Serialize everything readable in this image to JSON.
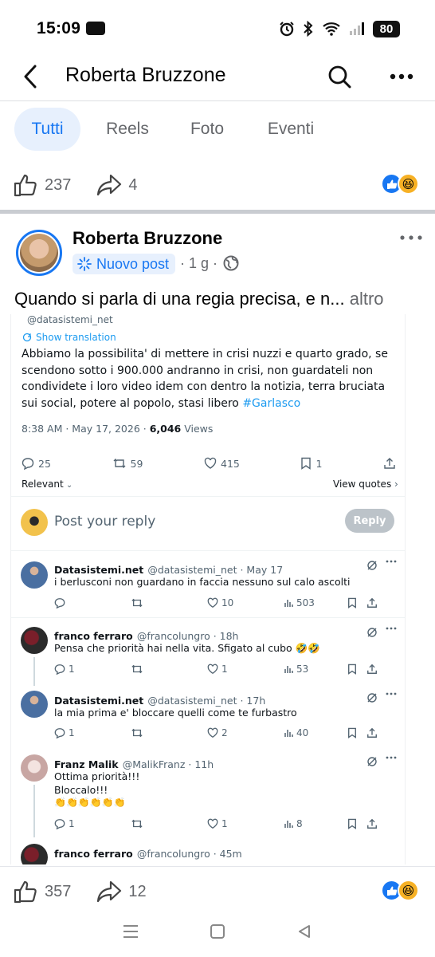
{
  "status_bar": {
    "time": "15:09",
    "battery": "80"
  },
  "header": {
    "title": "Roberta Bruzzone"
  },
  "tabs": [
    {
      "label": "Tutti",
      "active": true
    },
    {
      "label": "Reels",
      "active": false
    },
    {
      "label": "Foto",
      "active": false
    },
    {
      "label": "Eventi",
      "active": false
    }
  ],
  "top_reactions": {
    "likes": "237",
    "shares": "4"
  },
  "post": {
    "author": "Roberta Bruzzone",
    "badge": "Nuovo post",
    "time": "· 1 g ·",
    "text": "Quando si parla di una regia precisa, e n...",
    "more": "altro"
  },
  "embedded": {
    "top_handle": "@datasistemi_net",
    "show_translation": "Show translation",
    "tweet_text": "Abbiamo la possibilita' di mettere in crisi nuzzi e quarto grado, se scendono sotto i 900.000 andranno in crisi, non guardateli non condividete i loro video idem con dentro la notizia, terra bruciata sui social, potere al popolo, stasi libero",
    "hashtag": "#Garlasco",
    "meta_time": "8:38 AM · May 17, 2026 · ",
    "views_count": "6,046",
    "views_label": " Views",
    "stats": {
      "replies": "25",
      "reposts": "59",
      "likes": "415",
      "bookmarks": "1"
    },
    "relevant": "Relevant",
    "view_quotes": "View quotes",
    "reply_placeholder": "Post your reply",
    "reply_button": "Reply",
    "comments": [
      {
        "name": "Datasistemi.net",
        "handle": "@datasistemi_net · May 17",
        "text": "i berlusconi non guardano in faccia nessuno sul calo ascolti",
        "replies": "",
        "reposts": "",
        "likes": "10",
        "views": "503"
      },
      {
        "name": "franco ferraro",
        "handle": "@francolungro · 18h",
        "text": "Pensa che priorità hai nella vita. Sfigato al cubo 🤣🤣",
        "replies": "1",
        "reposts": "",
        "likes": "1",
        "views": "53"
      },
      {
        "name": "Datasistemi.net",
        "handle": "@datasistemi_net · 17h",
        "text": "la mia prima e' bloccare quelli come te furbastro",
        "replies": "1",
        "reposts": "",
        "likes": "2",
        "views": "40"
      },
      {
        "name": "Franz Malik",
        "handle": "@MalikFranz · 11h",
        "text": "Ottima priorità!!!",
        "text2": "Bloccalo!!!",
        "text3": "👏👏👏👏👏👏",
        "replies": "1",
        "reposts": "",
        "likes": "1",
        "views": "8"
      },
      {
        "name": "franco ferraro",
        "handle": "@francolungro · 45m"
      }
    ]
  },
  "bottom_reactions": {
    "likes": "357",
    "shares": "12"
  },
  "colors": {
    "fb_blue": "#1877f2",
    "x_blue": "#1d9bf0",
    "muted": "#65676b"
  }
}
